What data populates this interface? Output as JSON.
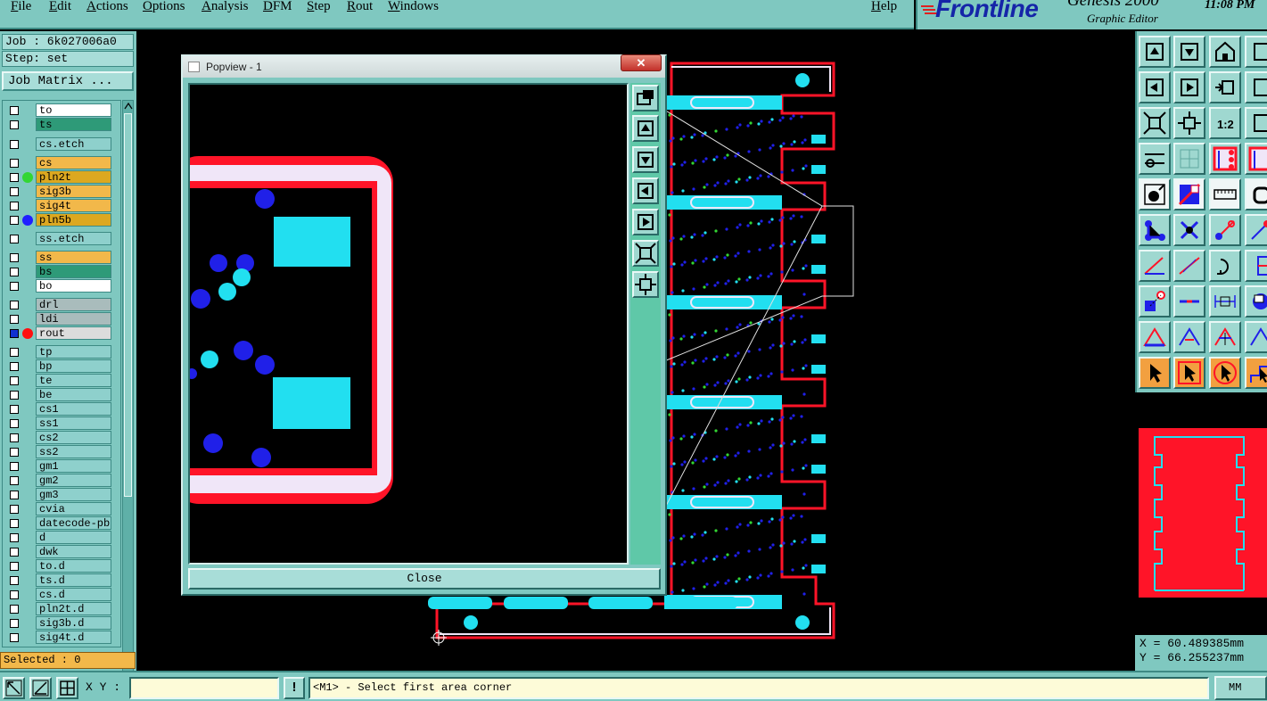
{
  "menu": {
    "items": [
      "File",
      "Edit",
      "Actions",
      "Options",
      "Analysis",
      "DFM",
      "Step",
      "Rout",
      "Windows"
    ],
    "help": "Help"
  },
  "brand": {
    "logo": "Frontline",
    "product": "Genesis 2000",
    "subtitle": "Graphic Editor",
    "clock": "11:08 PM"
  },
  "job": {
    "job_line": "Job : 6k027006a0",
    "step_line": "Step: set",
    "matrix_button": "Job Matrix ..."
  },
  "layers": [
    {
      "name": "to",
      "color": "#ffffff",
      "dot": ""
    },
    {
      "name": "ts",
      "color": "#2e9a78",
      "dot": ""
    },
    {
      "name": "cs.etch",
      "color": "#8ed0cc",
      "dot": ""
    },
    {
      "name": "cs",
      "color": "#f2b84a",
      "dot": ""
    },
    {
      "name": "pln2t",
      "color": "#dca820",
      "dot": "#33d633"
    },
    {
      "name": "sig3b",
      "color": "#f2b84a",
      "dot": ""
    },
    {
      "name": "sig4t",
      "color": "#f2b84a",
      "dot": ""
    },
    {
      "name": "pln5b",
      "color": "#dca820",
      "dot": "#2020ff"
    },
    {
      "name": "ss.etch",
      "color": "#8ed0cc",
      "dot": ""
    },
    {
      "name": "ss",
      "color": "#f2b84a",
      "dot": ""
    },
    {
      "name": "bs",
      "color": "#2e9a78",
      "dot": ""
    },
    {
      "name": "bo",
      "color": "#ffffff",
      "dot": ""
    },
    {
      "name": "drl",
      "color": "#a9bcbc",
      "dot": ""
    },
    {
      "name": "ldi",
      "color": "#a9bcbc",
      "dot": ""
    },
    {
      "name": "rout",
      "color": "#dcdcdc",
      "dot": "#ff1010",
      "active": true
    },
    {
      "name": "tp",
      "color": "#8ed0cc",
      "dot": ""
    },
    {
      "name": "bp",
      "color": "#8ed0cc",
      "dot": ""
    },
    {
      "name": "te",
      "color": "#8ed0cc",
      "dot": ""
    },
    {
      "name": "be",
      "color": "#8ed0cc",
      "dot": ""
    },
    {
      "name": "cs1",
      "color": "#8ed0cc",
      "dot": ""
    },
    {
      "name": "ss1",
      "color": "#8ed0cc",
      "dot": ""
    },
    {
      "name": "cs2",
      "color": "#8ed0cc",
      "dot": ""
    },
    {
      "name": "ss2",
      "color": "#8ed0cc",
      "dot": ""
    },
    {
      "name": "gm1",
      "color": "#8ed0cc",
      "dot": ""
    },
    {
      "name": "gm2",
      "color": "#8ed0cc",
      "dot": ""
    },
    {
      "name": "gm3",
      "color": "#8ed0cc",
      "dot": ""
    },
    {
      "name": "cvia",
      "color": "#8ed0cc",
      "dot": ""
    },
    {
      "name": "datecode-pbe",
      "color": "#8ed0cc",
      "dot": ""
    },
    {
      "name": "d",
      "color": "#8ed0cc",
      "dot": ""
    },
    {
      "name": "dwk",
      "color": "#8ed0cc",
      "dot": ""
    },
    {
      "name": "to.d",
      "color": "#8ed0cc",
      "dot": ""
    },
    {
      "name": "ts.d",
      "color": "#8ed0cc",
      "dot": ""
    },
    {
      "name": "cs.d",
      "color": "#8ed0cc",
      "dot": ""
    },
    {
      "name": "pln2t.d",
      "color": "#8ed0cc",
      "dot": ""
    },
    {
      "name": "sig3b.d",
      "color": "#8ed0cc",
      "dot": ""
    },
    {
      "name": "sig4t.d",
      "color": "#8ed0cc",
      "dot": ""
    }
  ],
  "selected": "Selected : 0",
  "popview": {
    "title": "Popview - 1",
    "close_x": "✕",
    "close_button": "Close"
  },
  "coords": {
    "x": "X =  60.489385mm",
    "y": "Y =  66.255237mm"
  },
  "status": {
    "xy_label": "X Y :",
    "xy_value": "",
    "bang": "!",
    "prompt": "<M1> - Select first area corner",
    "units": "MM"
  },
  "colors": {
    "panel": "#7fc8c0",
    "rout": "#ff1428",
    "outline": "#f0e6f8",
    "cyan": "#22dff0",
    "blue": "#2020e8"
  }
}
